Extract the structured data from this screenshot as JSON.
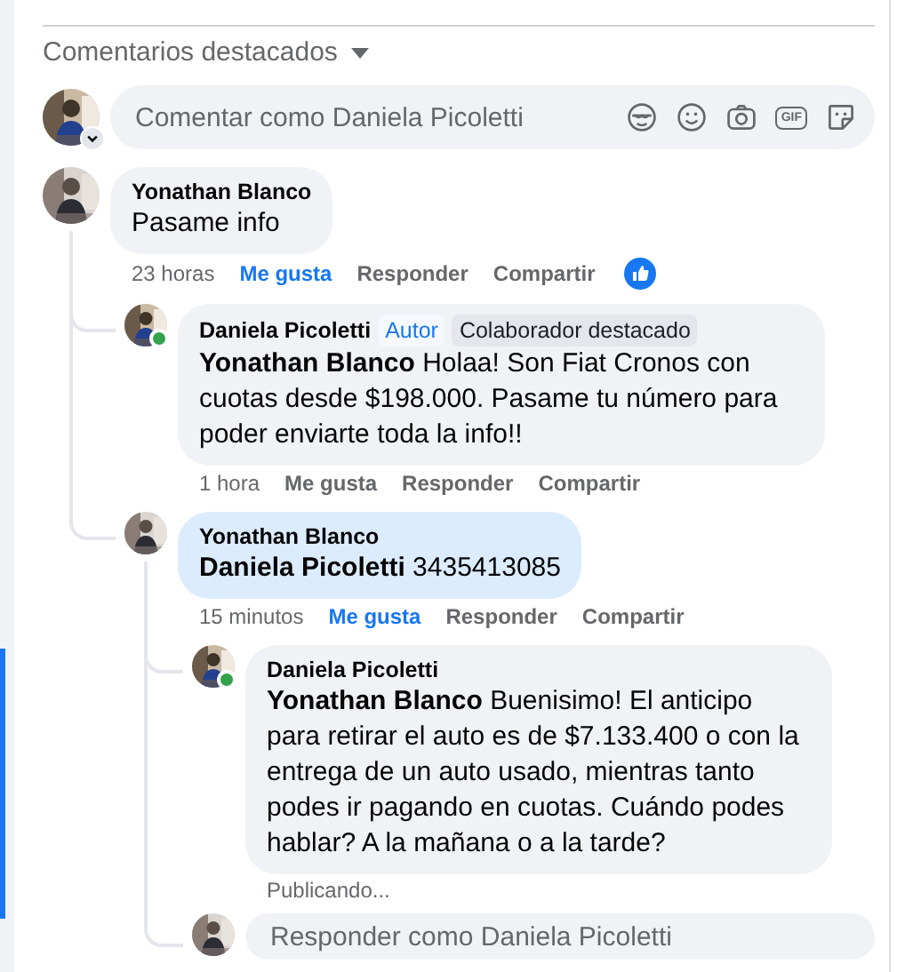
{
  "section": {
    "title": "Comentarios destacados"
  },
  "composer": {
    "placeholder": "Comentar como Daniela Picoletti",
    "gif_label": "GIF"
  },
  "comments": [
    {
      "author": "Yonathan Blanco",
      "online": false,
      "highlighted": false,
      "text": "Pasame info",
      "time": "23 horas",
      "liked": true,
      "actions": [
        "Me gusta",
        "Responder",
        "Compartir"
      ],
      "reaction": {
        "kind": "like"
      },
      "children": [
        {
          "author": "Daniela Picoletti",
          "online": true,
          "highlighted": false,
          "badges": [
            {
              "label": "Autor",
              "kind": "author"
            },
            {
              "label": "Colaborador destacado",
              "kind": "contributor"
            }
          ],
          "text": "**Yonathan Blanco** Holaa! Son Fiat Cronos con cuotas desde $198.000. Pasame tu número para poder enviarte toda la info!!",
          "time": "1 hora",
          "liked": false,
          "actions": [
            "Me gusta",
            "Responder",
            "Compartir"
          ]
        },
        {
          "author": "Yonathan Blanco",
          "online": false,
          "highlighted": true,
          "text": "**Daniela Picoletti** 3435413085",
          "time": "15 minutos",
          "liked": true,
          "actions": [
            "Me gusta",
            "Responder",
            "Compartir"
          ],
          "children": [
            {
              "author": "Daniela Picoletti",
              "online": true,
              "highlighted": false,
              "text": "**Yonathan Blanco** Buenisimo! El anticipo para retirar el auto es de $7.133.400 o con la entrega de un auto usado, mientras tanto podes ir pagando en cuotas. Cuándo podes hablar? A la mañana o a la tarde?",
              "status": "Publicando..."
            }
          ],
          "reply_box": {
            "placeholder": "Responder como Daniela Picoletti"
          }
        }
      ]
    }
  ]
}
